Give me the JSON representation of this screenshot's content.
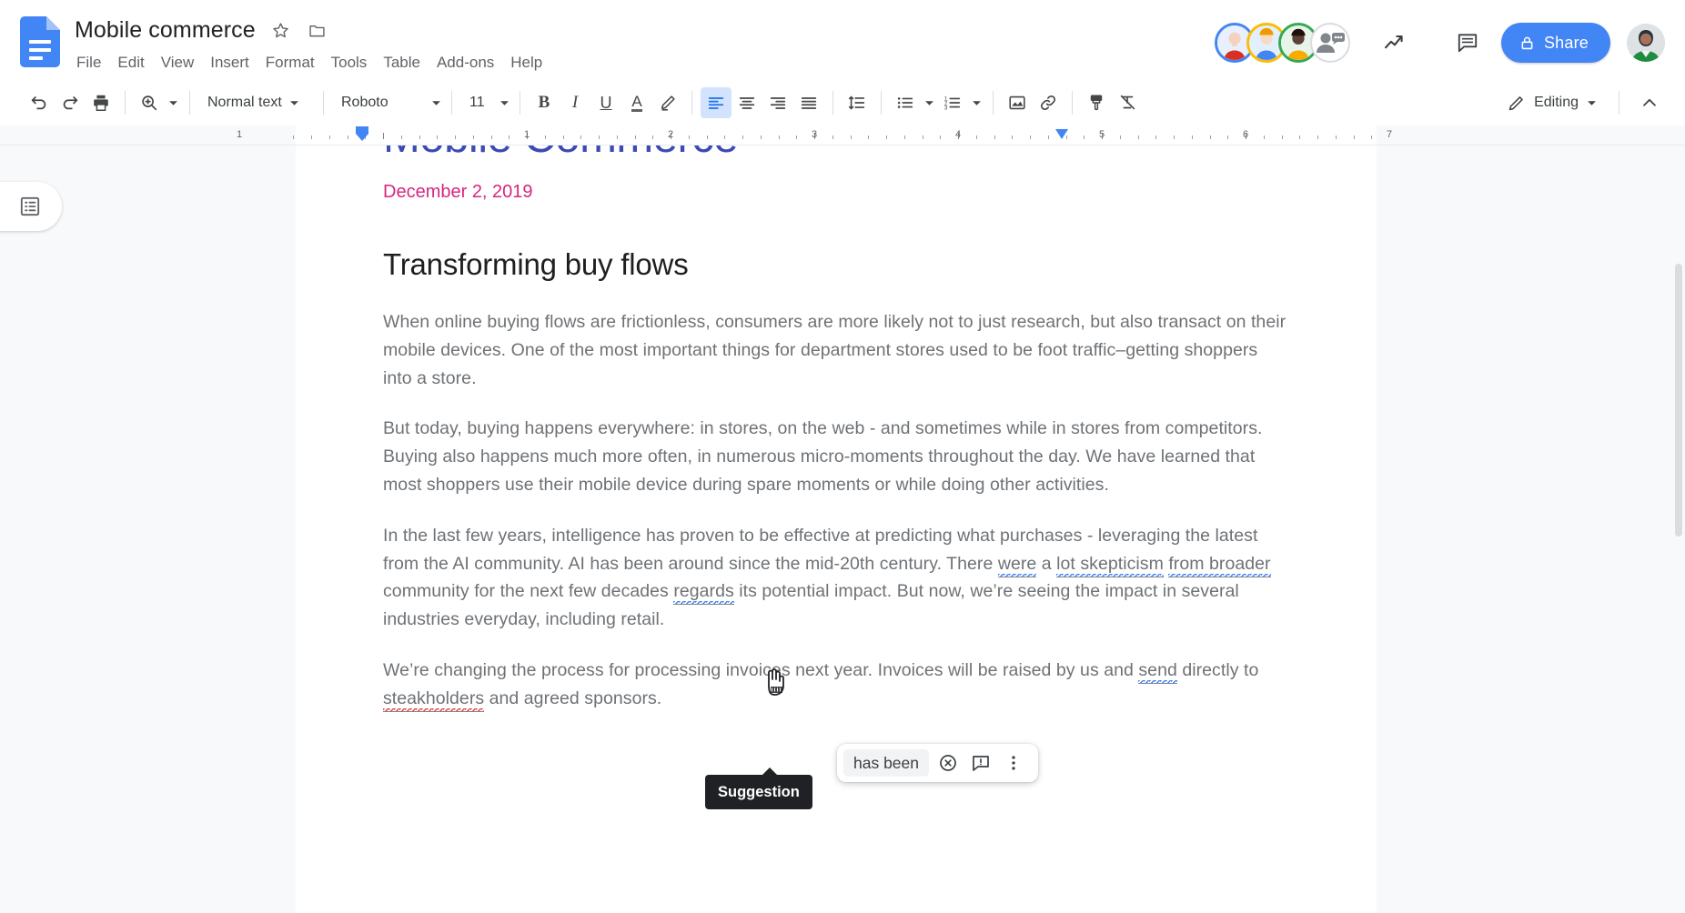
{
  "header": {
    "doc_title": "Mobile commerce",
    "star_icon": "star-icon",
    "folder_icon": "folder-icon",
    "logo_icon": "google-docs-logo-icon",
    "menus": [
      "File",
      "Edit",
      "View",
      "Insert",
      "Format",
      "Tools",
      "Table",
      "Add-ons",
      "Help"
    ],
    "activity_icon": "activity-trending-icon",
    "comments_icon": "comment-history-icon",
    "share_label": "Share",
    "share_lock_icon": "lock-icon",
    "share_color": "#4285f4",
    "add_collaborator_icon": "add-person-icon",
    "user_avatar_icon": "user-avatar-icon",
    "collaborator_ring_colors": [
      "#4285f4",
      "#fbbc04",
      "#34a853"
    ]
  },
  "toolbar": {
    "undo_icon": "undo-icon",
    "redo_icon": "redo-icon",
    "print_icon": "print-icon",
    "zoom_icon": "zoom-spellcheck-icon",
    "paragraph_style": "Normal text",
    "font_family": "Roboto",
    "font_size": "11",
    "bold_label": "B",
    "italic_label": "I",
    "underline_label": "U",
    "text_color_label": "A",
    "highlight_icon": "highlight-pen-icon",
    "align_left_icon": "align-left-icon",
    "align_center_icon": "align-center-icon",
    "align_right_icon": "align-right-icon",
    "align_justify_icon": "align-justify-icon",
    "line_spacing_icon": "line-spacing-icon",
    "bulleted_list_icon": "bulleted-list-icon",
    "numbered_list_icon": "numbered-list-icon",
    "insert_image_icon": "insert-image-icon",
    "insert_link_icon": "insert-link-icon",
    "paint_format_icon": "paint-format-icon",
    "clear_format_icon": "clear-formatting-icon",
    "mode_label": "Editing",
    "mode_icon": "pencil-icon",
    "collapse_icon": "chevron-up-icon",
    "active_alignment": "align-left",
    "active_bg": "#d3e3fd"
  },
  "ruler": {
    "numbers": [
      "1",
      "1",
      "2",
      "3",
      "4",
      "5",
      "6",
      "7"
    ],
    "marker_color": "#4285f4"
  },
  "sidebar": {
    "outline_toggle_icon": "document-outline-icon"
  },
  "document": {
    "title": "Mobile Commerce",
    "title_color": "#3c4bb3",
    "date": "December 2, 2019",
    "date_color": "#d6277e",
    "heading": "Transforming buy flows",
    "paragraphs": [
      {
        "id": "p1",
        "segments": [
          {
            "text": "When online buying flows are frictionless, consumers are more likely not to  just research, but also transact on their mobile devices. One of the most important things for department stores used to be foot traffic–getting shoppers into a store.",
            "mark": "none"
          }
        ]
      },
      {
        "id": "p2",
        "segments": [
          {
            "text": "But today, buying happens everywhere: in stores, on the web - and sometimes while in stores from competitors. Buying also happens much more often, in numerous micro-moments throughout the day. We have learned that most shoppers use their mobile device during spare moments or while doing other activities.",
            "mark": "none"
          }
        ]
      },
      {
        "id": "p3",
        "segments": [
          {
            "text": "In the last few years, intelligence has proven to be effective at predicting what purchases - leveraging the latest from the AI community. AI has been around since the mid-20th century. There ",
            "mark": "none"
          },
          {
            "text": "were",
            "mark": "grammar"
          },
          {
            "text": " a ",
            "mark": "none"
          },
          {
            "text": "lot skepticism",
            "mark": "grammar"
          },
          {
            "text": " ",
            "mark": "none"
          },
          {
            "text": "from broader",
            "mark": "grammar"
          },
          {
            "text": " community for the next few decades ",
            "mark": "none"
          },
          {
            "text": "regards",
            "mark": "grammar"
          },
          {
            "text": " its potential impact. But now, we’re seeing the impact in several industries everyday, including retail.",
            "mark": "none"
          }
        ]
      },
      {
        "id": "p4",
        "segments": [
          {
            "text": "We’re changing the process for processing invoices next year. Invoices will be raised by us and ",
            "mark": "none"
          },
          {
            "text": "send",
            "mark": "grammar"
          },
          {
            "text": " directly to ",
            "mark": "none"
          },
          {
            "text": "steakholders",
            "mark": "spelling"
          },
          {
            "text": " and agreed sponsors.",
            "mark": "none"
          }
        ]
      }
    ],
    "grammar_squiggle_color": "#4285f4",
    "spelling_squiggle_color": "#ea4335"
  },
  "suggestion_popup": {
    "suggested_text": "has been",
    "reject_icon": "reject-circle-x-icon",
    "comment_icon": "comment-suggestion-icon",
    "more_icon": "more-vertical-icon",
    "tooltip_label": "Suggestion",
    "tooltip_bg": "#202124",
    "cursor_icon": "hand-pointer-cursor"
  }
}
